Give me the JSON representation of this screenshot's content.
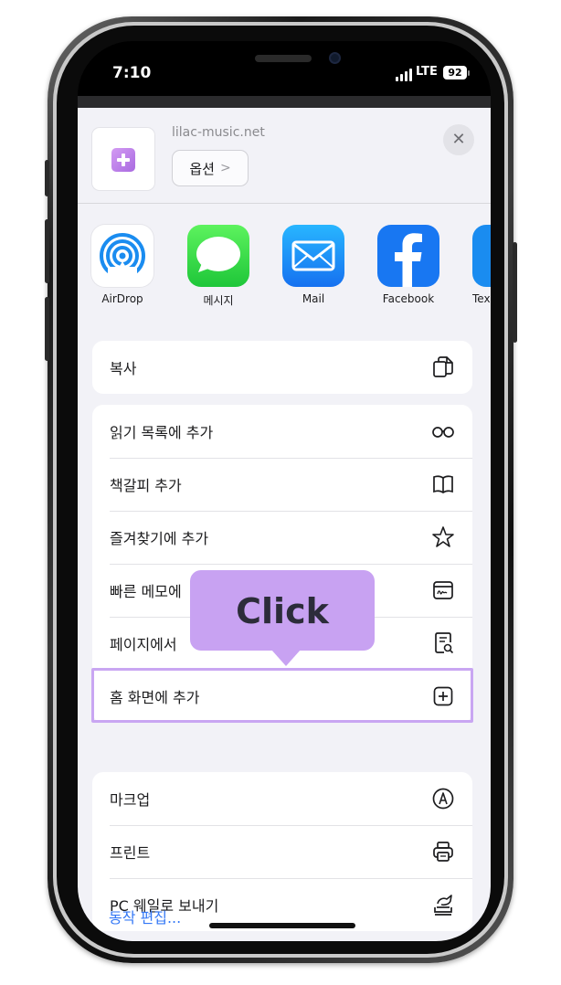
{
  "status_bar": {
    "time": "7:10",
    "network": "LTE",
    "battery": "92"
  },
  "share_sheet": {
    "site_url": "lilac-music.net",
    "options_label": "옵션",
    "close_icon": "close-icon",
    "apps": [
      {
        "label": "AirDrop",
        "icon": "airdrop-icon"
      },
      {
        "label": "메시지",
        "icon": "messages-icon"
      },
      {
        "label": "Mail",
        "icon": "mail-icon"
      },
      {
        "label": "Facebook",
        "icon": "facebook-icon"
      },
      {
        "label": "Tex",
        "icon": "text-app-icon"
      }
    ],
    "groups": [
      [
        {
          "label": "복사",
          "icon": "copy-icon"
        }
      ],
      [
        {
          "label": "읽기 목록에 추가",
          "icon": "glasses-icon"
        },
        {
          "label": "책갈피 추가",
          "icon": "book-icon"
        },
        {
          "label": "즐겨찾기에 추가",
          "icon": "star-icon"
        },
        {
          "label": "빠른 메모에",
          "icon": "quick-note-icon"
        },
        {
          "label": "페이지에서",
          "icon": "find-in-page-icon"
        },
        {
          "label": "홈 화면에 추가",
          "icon": "add-square-icon"
        }
      ],
      [
        {
          "label": "마크업",
          "icon": "markup-icon"
        },
        {
          "label": "프린트",
          "icon": "printer-icon"
        },
        {
          "label": "PC 웨일로 보내기",
          "icon": "whale-send-icon"
        }
      ]
    ],
    "edit_actions": "동작 편집..."
  },
  "callout": {
    "text": "Click",
    "color": "#c8a2f2"
  },
  "colors": {
    "accent_blue": "#3478f6",
    "highlight": "#c9a6f2"
  }
}
